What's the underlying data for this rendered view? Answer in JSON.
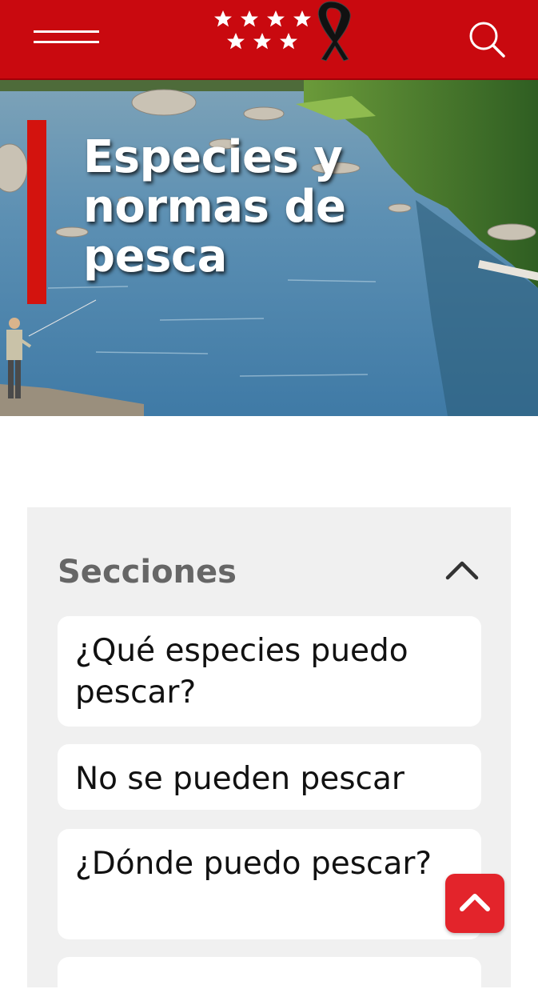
{
  "header": {
    "menu_icon": "hamburger-menu-icon",
    "logo_icon": "stars-logo-with-mourning-ribbon",
    "search_icon": "search-icon",
    "background_color": "#c9090f"
  },
  "hero": {
    "title": "Especies y normas de pesca",
    "accent_color": "#d3130e"
  },
  "sections": {
    "title": "Secciones",
    "toggle_icon": "chevron-up-icon",
    "items": [
      {
        "label": "¿Qué especies puedo pescar?"
      },
      {
        "label": "No se pueden pescar"
      },
      {
        "label": "¿Dónde puedo pescar?"
      }
    ]
  },
  "back_to_top": {
    "icon": "chevron-up-icon",
    "color": "#e3242b"
  }
}
